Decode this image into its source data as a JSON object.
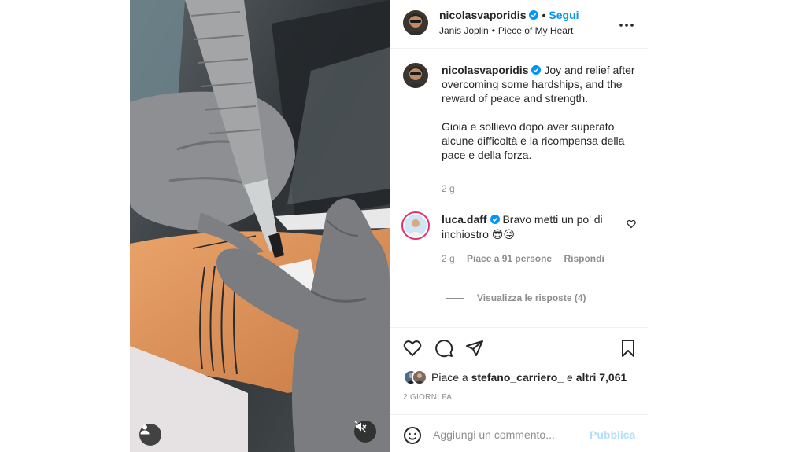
{
  "colors": {
    "accent": "#0095f6",
    "text": "#262626",
    "muted": "#8e8e8e",
    "publish_disabled": "#b2dffc",
    "story_ring": "#e1306c"
  },
  "media": {
    "tag_icon": "user-tag-icon",
    "mute_icon": "speaker-muted-icon"
  },
  "header": {
    "username": "nicolasvaporidis",
    "separator": "•",
    "follow_label": "Segui",
    "audio_artist": "Janis Joplin",
    "audio_separator": "•",
    "audio_title": "Piece of My Heart",
    "more_icon": "more-options-icon"
  },
  "caption": {
    "username": "nicolasvaporidis",
    "text_en": "Joy and relief after overcoming some hardships, and the reward of peace and strength.",
    "text_it": "Gioia e sollievo dopo aver superato alcune difficoltà e la ricompensa della pace e della forza.",
    "time": "2 g"
  },
  "comment": {
    "username": "luca.daff",
    "text": "Bravo metti un po' di inchiostro 😎😜",
    "time": "2 g",
    "likes": "Piace a 91 persone",
    "reply_label": "Rispondi",
    "view_replies": "Visualizza le risposte (4)"
  },
  "actions": {
    "like_icon": "heart-icon",
    "comment_icon": "comment-icon",
    "share_icon": "paper-plane-icon",
    "save_icon": "bookmark-icon"
  },
  "likes": {
    "prefix": "Piace a",
    "user": "stefano_carriero_",
    "middle": "e",
    "others": "altri 7,061"
  },
  "date": "2 GIORNI FA",
  "add_comment": {
    "placeholder": "Aggiungi un commento...",
    "publish_label": "Pubblica",
    "emoji_icon": "emoji-icon"
  }
}
